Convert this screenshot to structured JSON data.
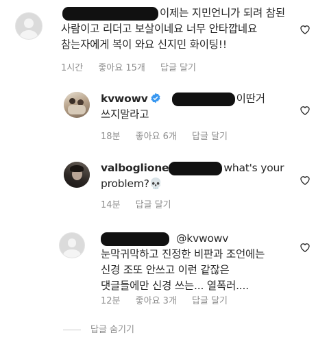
{
  "comments": [
    {
      "lines": [
        "이제는 지민언니가 되려 참된",
        "사람이고 리더고 보살이네요 너무 안타깝네요",
        "참는자에게 복이 와요 신지민 화이팅!!"
      ],
      "time": "1시간",
      "likes": "좋아요 15개",
      "reply": "답글 달기"
    },
    {
      "username": "kvwowv",
      "lines": [
        "이딴거",
        "쓰지말라고"
      ],
      "time": "18분",
      "likes": "좋아요 6개",
      "reply": "답글 달기"
    },
    {
      "username": "valboglione",
      "lines": [
        "what's your",
        "problem?💀"
      ],
      "time": "14분",
      "reply": "답글 달기"
    },
    {
      "mention": "@kvwowv",
      "lines": [
        "눈막귀막하고 진정한 비판과 조언에는",
        "신경 조또 안쓰고 이런 같잖은",
        "댓글들에만 신경 쓰는... 열폭러...."
      ],
      "time": "12분",
      "likes": "좋아요 3개",
      "reply": "답글 달기"
    }
  ],
  "hide_replies": "답글 숨기기",
  "icons": {
    "heart": "heart-outline-icon",
    "verified": "verified-badge-icon",
    "avatar_default": "default-avatar-icon"
  },
  "colors": {
    "text": "#262626",
    "meta": "#8e8e8e",
    "verified": "#3897f0"
  }
}
